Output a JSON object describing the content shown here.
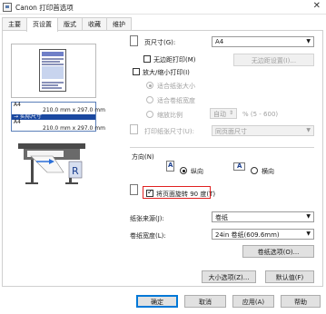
{
  "window": {
    "title": "Canon      打印首选项",
    "close_symbol": "✕"
  },
  "tabs": [
    {
      "label": "主要"
    },
    {
      "label": "页设置"
    },
    {
      "label": "版式"
    },
    {
      "label": "收藏"
    },
    {
      "label": "维护"
    }
  ],
  "preview_info": {
    "lines": [
      "A4",
      "210.0 mm x 297.0 mm",
      "→ 实际尺寸",
      "A4",
      "210.0 mm x 297.0 mm"
    ]
  },
  "page_size": {
    "label": "页尺寸(G):",
    "value": "A4"
  },
  "borderless": {
    "label": "无边距打印(M)",
    "checked": false,
    "settings_button": "无边距设置(I)..."
  },
  "enlarge": {
    "label": "放大/缩小打印(I)",
    "checked": false,
    "fit_paper": "适合纸张大小",
    "fit_width": "适合卷纸宽度",
    "scaling": "缩放比例",
    "scaling_value": "自动",
    "scaling_unit": "% (5 - 600)",
    "output_label": "打印纸张尺寸(U):",
    "output_value": "同页面尺寸"
  },
  "orientation": {
    "label": "方向(N)",
    "portrait": "纵向",
    "landscape": "横向",
    "portrait_selected": true
  },
  "rotate": {
    "label": "将页面旋转 90 度(T)",
    "checked": true
  },
  "paper_source": {
    "label": "纸张来源(J):",
    "value": "卷纸"
  },
  "roll_width": {
    "label": "卷纸宽度(L):",
    "value": "24in 卷纸(609.6mm)"
  },
  "buttons": {
    "roll_options": "卷纸选项(O)...",
    "size_options": "大小选项(Z)...",
    "defaults": "默认值(F)",
    "ok": "确定",
    "cancel": "取消",
    "apply": "应用(A)",
    "help": "帮助"
  }
}
